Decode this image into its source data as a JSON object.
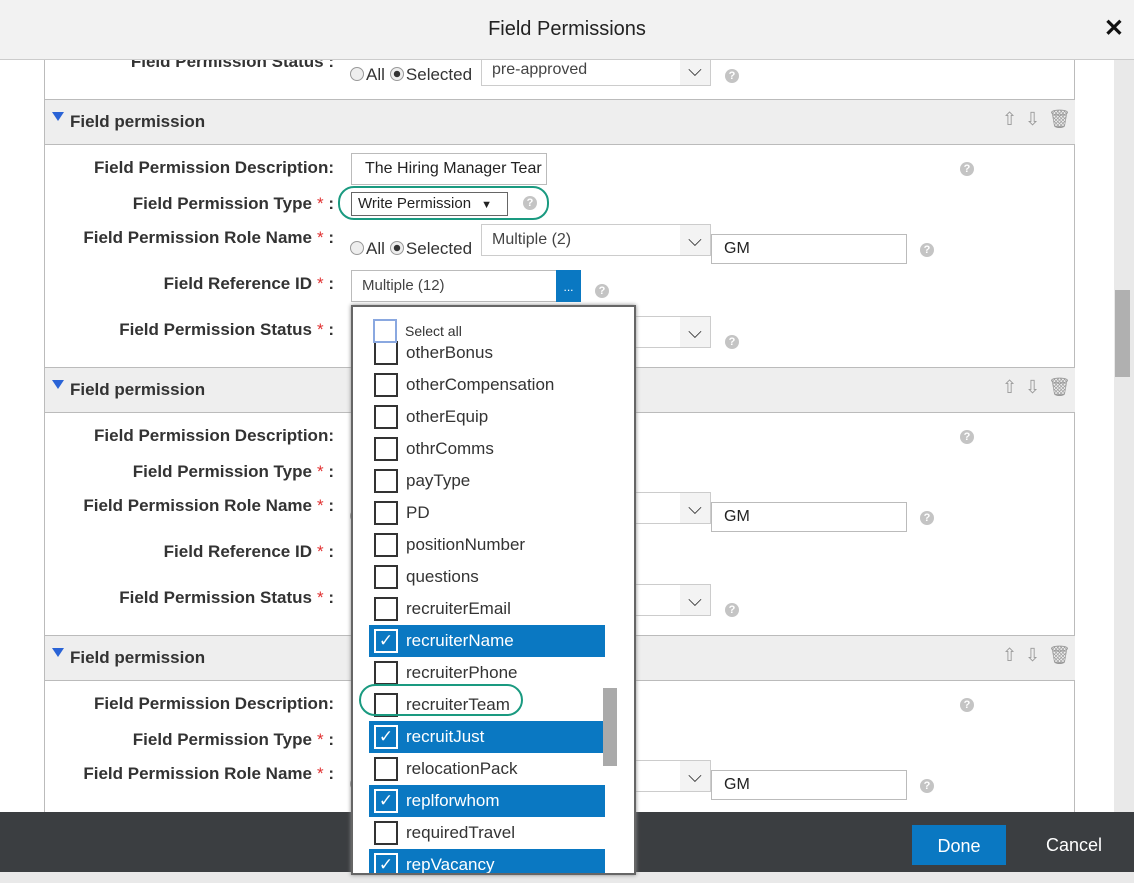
{
  "dialog": {
    "title": "Field Permissions",
    "close_icon": "close-icon"
  },
  "labels": {
    "desc": "Field Permission Description:",
    "type": "Field Permission Type",
    "role": "Field Permission Role Name",
    "ref": "Field Reference ID",
    "status": "Field Permission Status",
    "colon": " :",
    "required": "*",
    "all": "All",
    "selected": "Selected",
    "help": "?"
  },
  "top_section": {
    "status_value": "pre-approved"
  },
  "sections": [
    {
      "header": "Field permission",
      "description": "The Hiring Manager Tear",
      "type": "Write Permission",
      "role_value": "Multiple (2)",
      "role_text": "GM",
      "ref_value": "Multiple (12)",
      "ref_button": "..."
    },
    {
      "header": "Field permission",
      "role_text": "GM"
    },
    {
      "header": "Field permission",
      "role_text": "GM"
    }
  ],
  "dropdown": {
    "select_all": "Select all",
    "items": [
      {
        "label": "otherBonus",
        "checked": false
      },
      {
        "label": "otherCompensation",
        "checked": false
      },
      {
        "label": "otherEquip",
        "checked": false
      },
      {
        "label": "othrComms",
        "checked": false
      },
      {
        "label": "payType",
        "checked": false
      },
      {
        "label": "PD",
        "checked": false
      },
      {
        "label": "positionNumber",
        "checked": false
      },
      {
        "label": "questions",
        "checked": false
      },
      {
        "label": "recruiterEmail",
        "checked": false
      },
      {
        "label": "recruiterName",
        "checked": true
      },
      {
        "label": "recruiterPhone",
        "checked": false
      },
      {
        "label": "recruiterTeam",
        "checked": false
      },
      {
        "label": "recruitJust",
        "checked": true
      },
      {
        "label": "relocationPack",
        "checked": false
      },
      {
        "label": "replforwhom",
        "checked": true
      },
      {
        "label": "requiredTravel",
        "checked": false
      },
      {
        "label": "repVacancy",
        "checked": true
      }
    ]
  },
  "footer": {
    "done": "Done",
    "cancel": "Cancel"
  },
  "colors": {
    "accent": "#0a78c2",
    "highlight": "#1a9a80",
    "footer": "#3b3e41"
  }
}
